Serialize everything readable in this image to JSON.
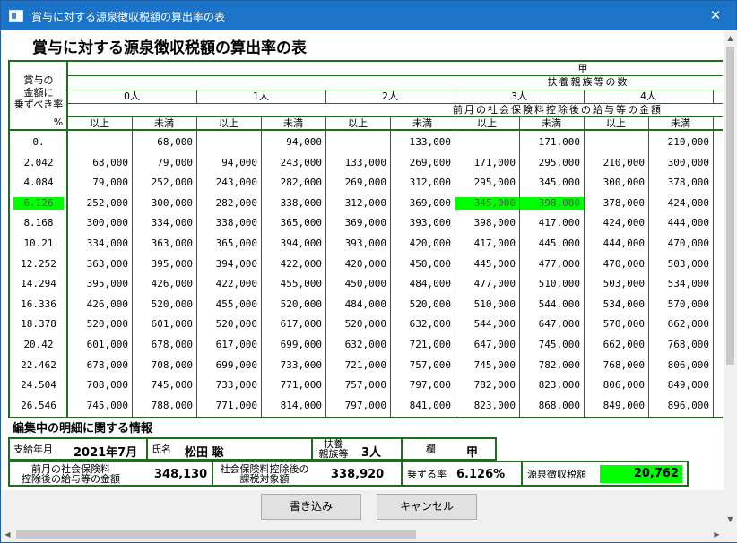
{
  "window": {
    "title": "賞与に対する源泉徴収税額の算出率の表",
    "close_glyph": "✕"
  },
  "heading": "賞与に対する源泉徴収税額の算出率の表",
  "table": {
    "header": {
      "kou": "甲",
      "fuyou": "扶養親族等の数",
      "rate_label_1": "賞与の",
      "rate_label_2": "金額に",
      "rate_label_3": "乗ずべき率",
      "pct": "%",
      "zengetsu": "前月の社会保険料控除後の給与等の金額",
      "ijou": "以上",
      "miman": "未満",
      "persons": [
        "0人",
        "1人",
        "2人",
        "3人",
        "4人"
      ]
    },
    "rows": [
      {
        "rate": "0.",
        "v": [
          "",
          "68,000",
          "",
          "94,000",
          "",
          "133,000",
          "",
          "171,000",
          "",
          "210,000"
        ]
      },
      {
        "rate": "2.042",
        "v": [
          "68,000",
          "79,000",
          "94,000",
          "243,000",
          "133,000",
          "269,000",
          "171,000",
          "295,000",
          "210,000",
          "300,000"
        ]
      },
      {
        "rate": "4.084",
        "v": [
          "79,000",
          "252,000",
          "243,000",
          "282,000",
          "269,000",
          "312,000",
          "295,000",
          "345,000",
          "300,000",
          "378,000"
        ]
      },
      {
        "rate": "6.126",
        "v": [
          "252,000",
          "300,000",
          "282,000",
          "338,000",
          "312,000",
          "369,000",
          "345,000",
          "398,000",
          "378,000",
          "424,000"
        ]
      },
      {
        "rate": "8.168",
        "v": [
          "300,000",
          "334,000",
          "338,000",
          "365,000",
          "369,000",
          "393,000",
          "398,000",
          "417,000",
          "424,000",
          "444,000"
        ]
      },
      {
        "rate": "10.21",
        "v": [
          "334,000",
          "363,000",
          "365,000",
          "394,000",
          "393,000",
          "420,000",
          "417,000",
          "445,000",
          "444,000",
          "470,000"
        ]
      },
      {
        "rate": "12.252",
        "v": [
          "363,000",
          "395,000",
          "394,000",
          "422,000",
          "420,000",
          "450,000",
          "445,000",
          "477,000",
          "470,000",
          "503,000"
        ]
      },
      {
        "rate": "14.294",
        "v": [
          "395,000",
          "426,000",
          "422,000",
          "455,000",
          "450,000",
          "484,000",
          "477,000",
          "510,000",
          "503,000",
          "534,000"
        ]
      },
      {
        "rate": "16.336",
        "v": [
          "426,000",
          "520,000",
          "455,000",
          "520,000",
          "484,000",
          "520,000",
          "510,000",
          "544,000",
          "534,000",
          "570,000"
        ]
      },
      {
        "rate": "18.378",
        "v": [
          "520,000",
          "601,000",
          "520,000",
          "617,000",
          "520,000",
          "632,000",
          "544,000",
          "647,000",
          "570,000",
          "662,000"
        ]
      },
      {
        "rate": "20.42",
        "v": [
          "601,000",
          "678,000",
          "617,000",
          "699,000",
          "632,000",
          "721,000",
          "647,000",
          "745,000",
          "662,000",
          "768,000"
        ]
      },
      {
        "rate": "22.462",
        "v": [
          "678,000",
          "708,000",
          "699,000",
          "733,000",
          "721,000",
          "757,000",
          "745,000",
          "782,000",
          "768,000",
          "806,000"
        ]
      },
      {
        "rate": "24.504",
        "v": [
          "708,000",
          "745,000",
          "733,000",
          "771,000",
          "757,000",
          "797,000",
          "782,000",
          "823,000",
          "806,000",
          "849,000"
        ]
      },
      {
        "rate": "26.546",
        "v": [
          "745,000",
          "788,000",
          "771,000",
          "814,000",
          "797,000",
          "841,000",
          "823,000",
          "868,000",
          "849,000",
          "896,000"
        ]
      }
    ],
    "highlight_color": "#00ff00"
  },
  "detail": {
    "section_title": "編集中の明細に関する情報",
    "shikyu_label": "支給年月",
    "shikyu_value": "2021年7月",
    "name_label": "氏名",
    "name_value": "松田 聡",
    "fuyou_label_1": "扶養",
    "fuyou_label_2": "親族等",
    "fuyou_value": "3人",
    "ran_label": "欄",
    "ran_value": "甲",
    "zengetsu_label_1": "前月の社会保険料",
    "zengetsu_label_2": "控除後の給与等の金額",
    "zengetsu_value": "348,130",
    "kazei_label_1": "社会保険料控除後の",
    "kazei_label_2": "課税対象額",
    "kazei_value": "338,920",
    "rate_label": "乗ずる率",
    "rate_value": "6.126%",
    "tax_label": "源泉徴収税額",
    "tax_value": "20,762"
  },
  "buttons": {
    "write": "書き込み",
    "cancel": "キャンセル"
  },
  "scroll": {
    "up": "▲",
    "down": "▼",
    "left": "◀",
    "right": "▶"
  }
}
